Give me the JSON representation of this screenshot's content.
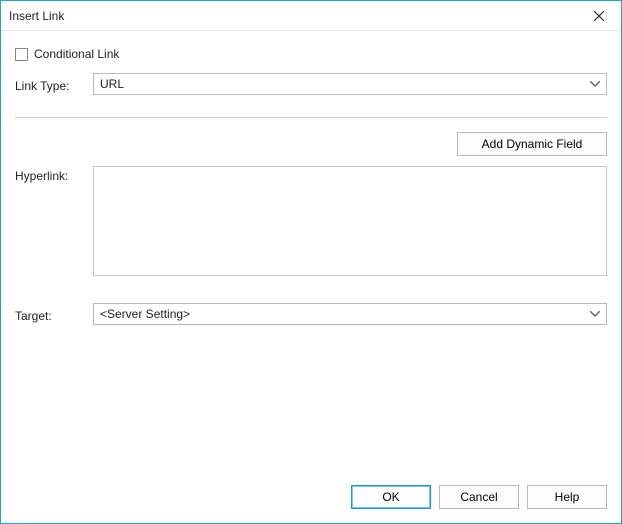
{
  "title": "Insert Link",
  "checkbox": {
    "label": "Conditional Link",
    "checked": false
  },
  "linkType": {
    "label": "Link Type:",
    "value": "URL"
  },
  "addDynamic": {
    "label": "Add Dynamic Field"
  },
  "hyperlink": {
    "label": "Hyperlink:",
    "value": ""
  },
  "target": {
    "label": "Target:",
    "value": "<Server Setting>"
  },
  "buttons": {
    "ok": "OK",
    "cancel": "Cancel",
    "help": "Help"
  }
}
